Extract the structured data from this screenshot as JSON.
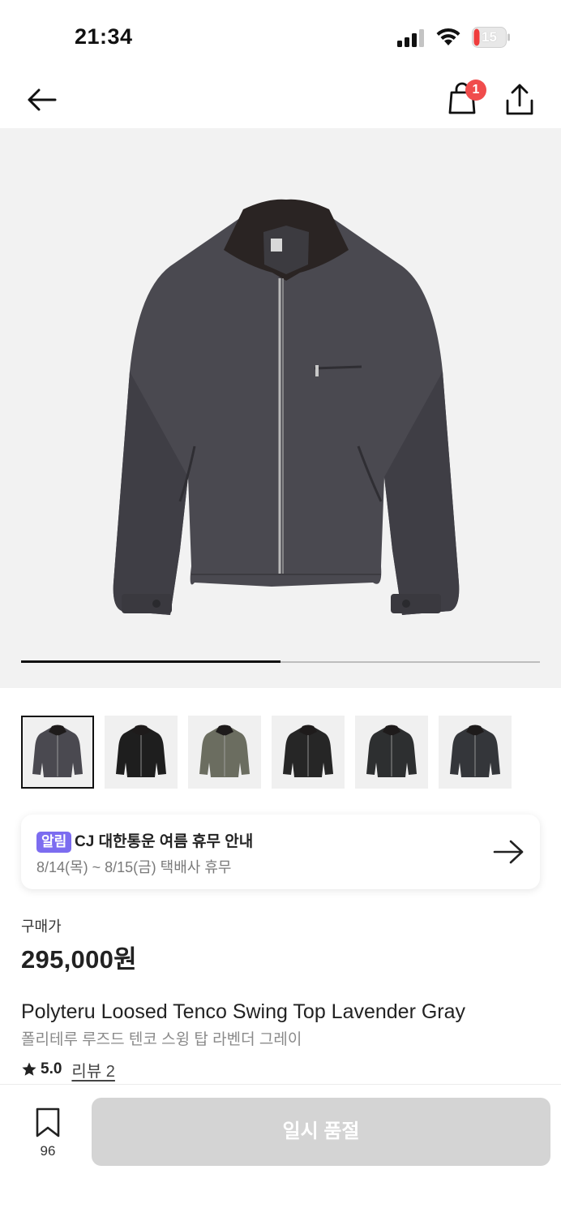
{
  "status_bar": {
    "time": "21:34",
    "battery": "15",
    "icons": [
      "signal-icon",
      "wifi-icon",
      "battery-icon"
    ]
  },
  "header": {
    "icons": [
      "back-arrow-icon",
      "shopping-bag-icon",
      "share-icon"
    ],
    "cart_badge": "1"
  },
  "gallery": {
    "progress": 0.5,
    "thumbnail_count": 6,
    "selected_index": 0,
    "thumbnail_colors": [
      "#4a4950",
      "#1e1e1e",
      "#6b6d60",
      "#262626",
      "#2d2f30",
      "#34363a"
    ]
  },
  "notice": {
    "tag": "알림",
    "title": "CJ 대한통운 여름 휴무 안내",
    "subtitle": "8/14(목) ~ 8/15(금) 택배사 휴무",
    "icon": "arrow-right-icon"
  },
  "product": {
    "price_label": "구매가",
    "price": "295,000원",
    "name_en": "Polyteru Loosed Tenco Swing Top Lavender Gray",
    "name_ko": "폴리테루 루즈드 텐코 스윙 탑 라벤더 그레이",
    "rating": "5.0",
    "review_label": "리뷰 2"
  },
  "bottom_bar": {
    "bookmark_count": "96",
    "button_label": "일시 품절"
  },
  "colors": {
    "badge": "#f04c4c",
    "notice_tag": "#7c6cf0",
    "disabled_button": "#d4d4d4",
    "jacket": "#4a4950"
  }
}
